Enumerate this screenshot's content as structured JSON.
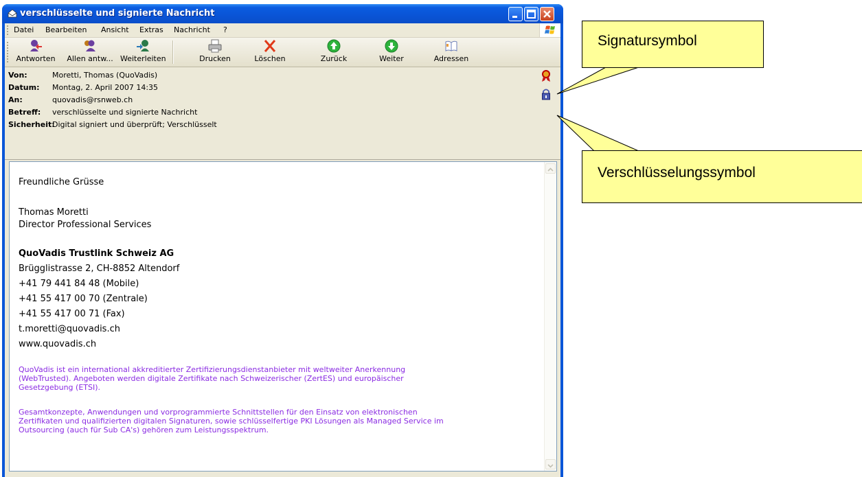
{
  "window": {
    "title": "verschlüsselte und signierte Nachricht"
  },
  "menu": [
    "Datei",
    "Bearbeiten",
    "Ansicht",
    "Extras",
    "Nachricht",
    "?"
  ],
  "toolbar": [
    "Antworten",
    "Allen antw...",
    "Weiterleiten",
    "Drucken",
    "Löschen",
    "Zurück",
    "Weiter",
    "Adressen"
  ],
  "headers": [
    {
      "key": "Von:",
      "value": "Moretti, Thomas (QuoVadis)"
    },
    {
      "key": "Datum:",
      "value": "Montag, 2. April 2007 14:35"
    },
    {
      "key": "An:",
      "value": "quovadis@rsnweb.ch"
    },
    {
      "key": "Betreff:",
      "value": "verschlüsselte und signierte Nachricht"
    },
    {
      "key": "Sicherheit:",
      "value": "Digital signiert und überprüft; Verschlüsselt"
    }
  ],
  "body": {
    "greeting": "Freundliche Grüsse",
    "name": "Thomas Moretti",
    "role": "Director Professional Services",
    "company": "QuoVadis Trustlink Schweiz AG",
    "address": "Brügglistrasse 2, CH-8852 Altendorf",
    "mobile": "+41 79 441 84 48 (Mobile)",
    "central": "+41 55 417 00 70 (Zentrale)",
    "fax": "+41 55 417 00 71 (Fax)",
    "email": "t.moretti@quovadis.ch",
    "web": "www.quovadis.ch",
    "para1": [
      "QuoVadis ist ein international akkreditierter Zertifizierungsdienstanbieter mit weltweiter Anerkennung",
      "(WebTrusted). Angeboten werden digitale Zertifikate nach Schweizerischer (ZertES) und europäischer",
      "Gesetzgebung (ETSI)."
    ],
    "para2": [
      "Gesamtkonzepte, Anwendungen und vorprogrammierte Schnittstellen für den Einsatz von elektronischen",
      "Zertifikaten und qualifizierten digitalen Signaturen, sowie schlüsselfertige PKI Lösungen als Managed Service im",
      "Outsourcing (auch für Sub CA's) gehören zum Leistungsspektrum."
    ]
  },
  "callouts": {
    "signature": "Signatursymbol",
    "encryption": "Verschlüsselungssymbol"
  },
  "colors": {
    "titlebar": "#0a54d6",
    "callout": "#ffff99",
    "purple_text": "#8a2be2"
  }
}
